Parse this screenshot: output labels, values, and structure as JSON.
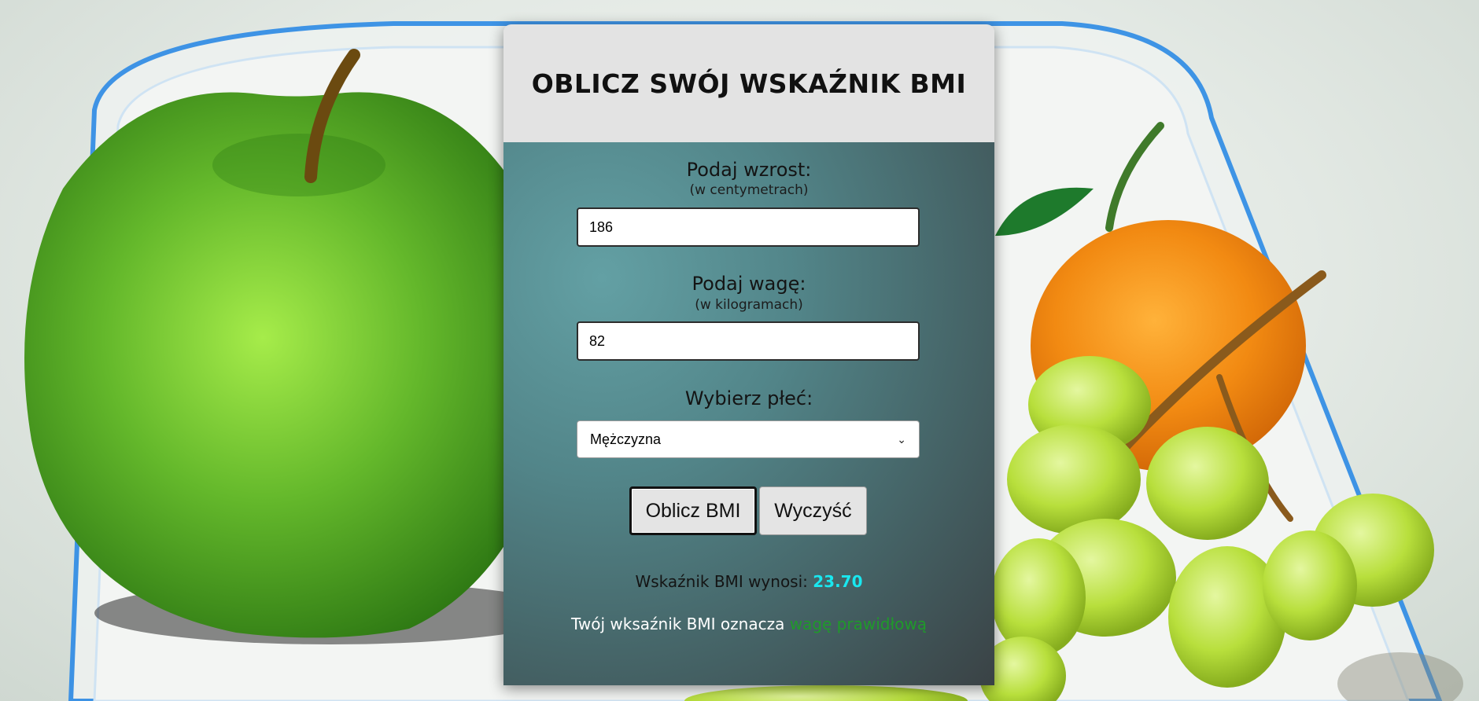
{
  "title": "OBLICZ SWÓJ WSKAŹNIK BMI",
  "height": {
    "label": "Podaj wzrost:",
    "unit_hint": "(w centymetrach)",
    "value": "186"
  },
  "weight": {
    "label": "Podaj wagę:",
    "unit_hint": "(w kilogramach)",
    "value": "82"
  },
  "sex": {
    "label": "Wybierz płeć:",
    "selected": "Mężczyzna"
  },
  "buttons": {
    "calculate": "Oblicz BMI",
    "clear": "Wyczyść"
  },
  "result": {
    "prefix": "Wskaźnik BMI wynosi:",
    "value": "23.70",
    "meaning_prefix": "Twój wksaźnik BMI oznacza",
    "meaning_value": "wagę prawidłową"
  },
  "colors": {
    "header_bg": "#e3e3e3",
    "bmi_value": "#19e8f0",
    "meaning_value": "#1f9a2a"
  },
  "icons": {
    "select_arrow": "chevron-down-icon"
  }
}
